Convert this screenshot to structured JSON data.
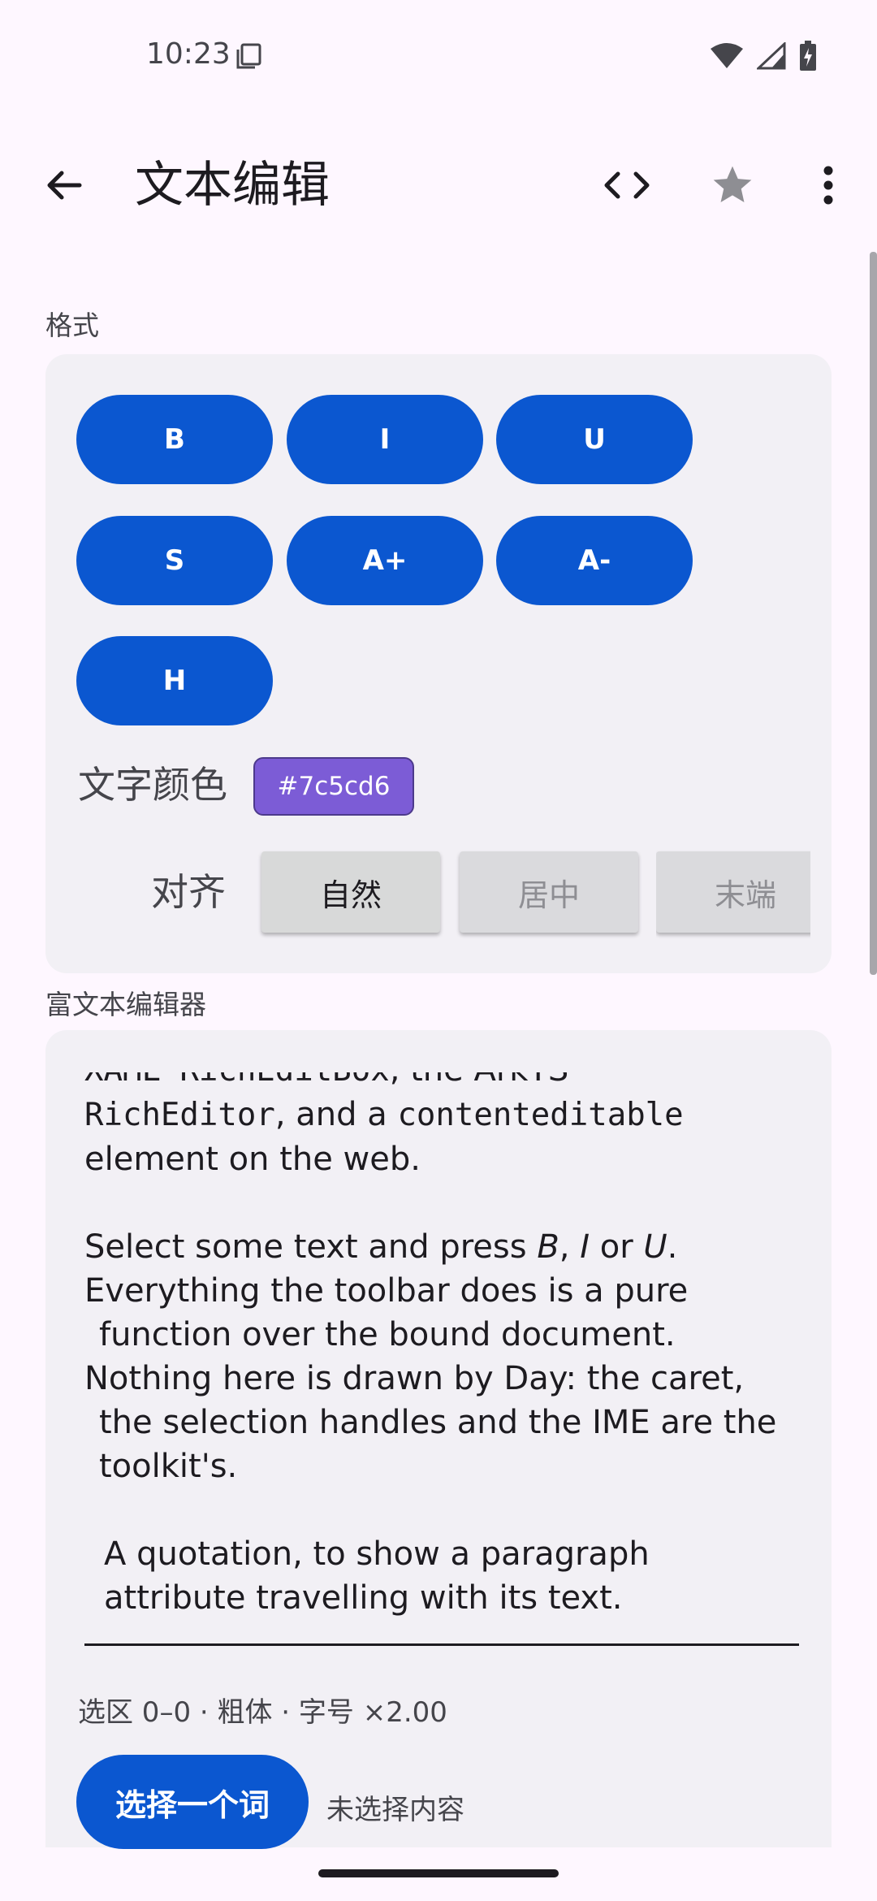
{
  "status_bar": {
    "time": "10:23"
  },
  "app_bar": {
    "title": "文本编辑"
  },
  "format_section": {
    "label": "格式",
    "buttons": [
      "B",
      "I",
      "U",
      "S",
      "A+",
      "A-",
      "H"
    ],
    "color_label": "文字颜色",
    "color_value": "#7c5cd6",
    "align_label": "对齐",
    "align_options": [
      "自然",
      "居中",
      "末端"
    ],
    "align_selected": "自然"
  },
  "editor_section": {
    "label": "富文本编辑器",
    "lines": {
      "l0_mono": "XAML RichEditBox",
      "l0_rest": ", the ArkTS",
      "l1_mono": "RichEditor",
      "l1_mid": ", and a ",
      "l1_mono2": "contenteditable",
      "l2": "element on the web.",
      "l3_a": "Select some text and press ",
      "l3_b": "B",
      "l3_c": ", ",
      "l3_d": "I",
      "l3_e": " or ",
      "l3_f": "U",
      "l3_g": ".",
      "l4": "Everything the toolbar does is a pure",
      "l5": "function over the bound document.",
      "l6": "Nothing here is drawn by Day: the caret,",
      "l7": "the selection handles and the IME are the",
      "l8": "toolkit's.",
      "l9": "A quotation, to show a paragraph",
      "l10": "attribute travelling with its text."
    },
    "selection_status": "选区 0–0 · 粗体 · 字号 ×2.00",
    "select_word_label": "选择一个词",
    "no_selection_label": "未选择内容"
  },
  "colors": {
    "accent": "#0B57D0",
    "text_color_chip": "#7C5CD6",
    "background": "#FEF7FF",
    "card": "#F2F0F5"
  },
  "icons": {
    "back": "arrow-left-icon",
    "code": "code-icon",
    "star": "star-icon",
    "more": "more-vert-icon"
  }
}
